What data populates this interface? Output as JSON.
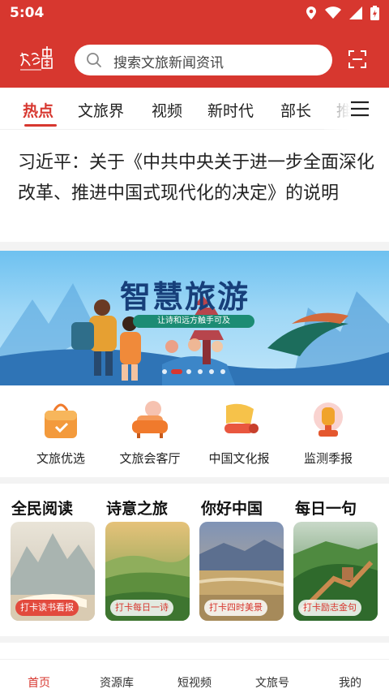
{
  "status_bar": {
    "time": "5:04"
  },
  "search": {
    "placeholder": "搜索文旅新闻资讯"
  },
  "tabs": [
    {
      "label": "热点",
      "active": true
    },
    {
      "label": "文旅界"
    },
    {
      "label": "视频"
    },
    {
      "label": "新时代"
    },
    {
      "label": "部长"
    },
    {
      "label": "推"
    }
  ],
  "headline": "习近平：关于《中共中央关于进一步全面深化改革、推进中国式现代化的决定》的说明",
  "banner": {
    "title": "智慧旅游",
    "subtitle": "让诗和远方触手可及"
  },
  "quick_links": [
    {
      "label": "文旅优选",
      "icon": "shopping-bag-icon"
    },
    {
      "label": "文旅会客厅",
      "icon": "sofa-icon"
    },
    {
      "label": "中国文化报",
      "icon": "scroll-icon"
    },
    {
      "label": "监测季报",
      "icon": "lantern-icon"
    }
  ],
  "sections": [
    {
      "title": "全民阅读",
      "badge": "打卡读书看报"
    },
    {
      "title": "诗意之旅",
      "badge": "打卡每日一诗"
    },
    {
      "title": "你好中国",
      "badge": "打卡四时美景"
    },
    {
      "title": "每日一句",
      "badge": "打卡励志金句"
    }
  ],
  "bottom_nav": [
    {
      "label": "首页",
      "active": true
    },
    {
      "label": "资源库"
    },
    {
      "label": "短视频"
    },
    {
      "label": "文旅号"
    },
    {
      "label": "我的"
    }
  ],
  "colors": {
    "brand_red": "#d7372f"
  }
}
